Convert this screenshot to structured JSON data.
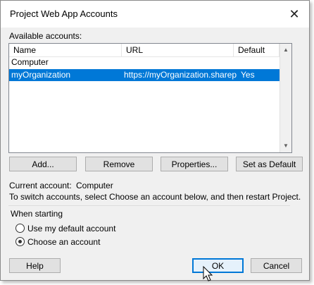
{
  "window": {
    "title": "Project Web App Accounts",
    "close_glyph": "✕"
  },
  "accounts_label": "Available accounts:",
  "list": {
    "headers": {
      "name": "Name",
      "url": "URL",
      "default": "Default"
    },
    "rows": [
      {
        "name": "Computer",
        "url": "",
        "default": ""
      },
      {
        "name": "myOrganization",
        "url": "https://myOrganization.sharep",
        "default": "Yes",
        "selected": true
      }
    ]
  },
  "buttons": {
    "add": "Add...",
    "remove": "Remove",
    "properties": "Properties...",
    "set_default": "Set as Default",
    "help": "Help",
    "ok": "OK",
    "cancel": "Cancel"
  },
  "current_account": {
    "label": "Current account:",
    "value": "Computer"
  },
  "instruction": "To switch accounts, select Choose an account below, and then restart Project.",
  "when_starting": {
    "label": "When starting",
    "options": [
      {
        "label": "Use my default account",
        "checked": false
      },
      {
        "label": "Choose an account",
        "checked": true
      }
    ]
  },
  "colors": {
    "selection": "#0078d7",
    "dialog_bg": "#f0f0f0"
  }
}
